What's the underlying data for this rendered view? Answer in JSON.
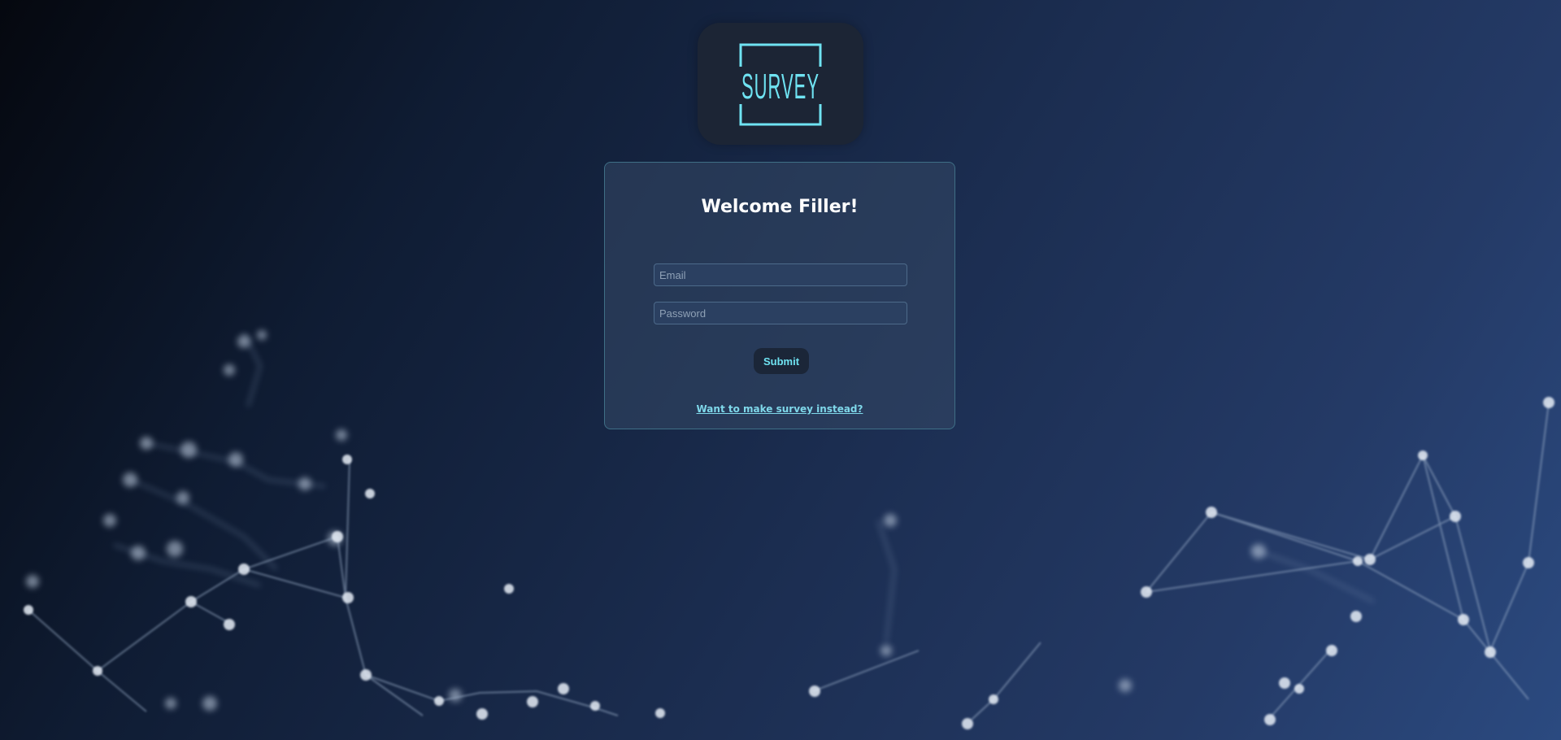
{
  "logo": {
    "text": "SURVEY",
    "color": "#6fe3f2"
  },
  "card": {
    "title": "Welcome Filler!",
    "email_placeholder": "Email",
    "password_placeholder": "Password",
    "submit_label": "Submit",
    "switch_link": "Want to make survey instead?"
  },
  "colors": {
    "accent": "#6fe3f2",
    "card_border": "#3f6f86",
    "button_bg": "#1b2638"
  }
}
